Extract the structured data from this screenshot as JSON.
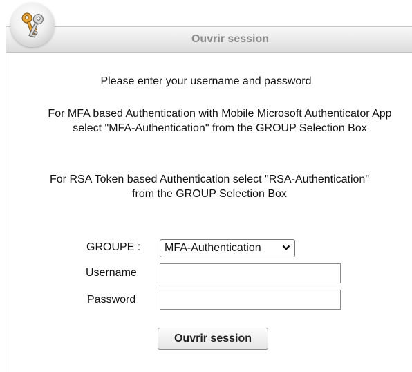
{
  "header": {
    "title": "Ouvrir session",
    "logo_icon": "keys-icon"
  },
  "messages": {
    "line1": "Please enter your username and password",
    "line2": "For MFA based Authentication with Mobile Microsoft Authenticator App select \"MFA-Authentication\" from the GROUP Selection Box",
    "line3": "For RSA Token based Authentication select \"RSA-Authentication\" from the GROUP Selection Box"
  },
  "form": {
    "group_label": "GROUPE :",
    "group_selected": "MFA-Authentication",
    "username_label": "Username",
    "username_value": "",
    "password_label": "Password",
    "password_value": "",
    "submit_label": "Ouvrir session"
  },
  "colors": {
    "header_text": "#8a8a8a",
    "border": "#b9b9b9"
  }
}
